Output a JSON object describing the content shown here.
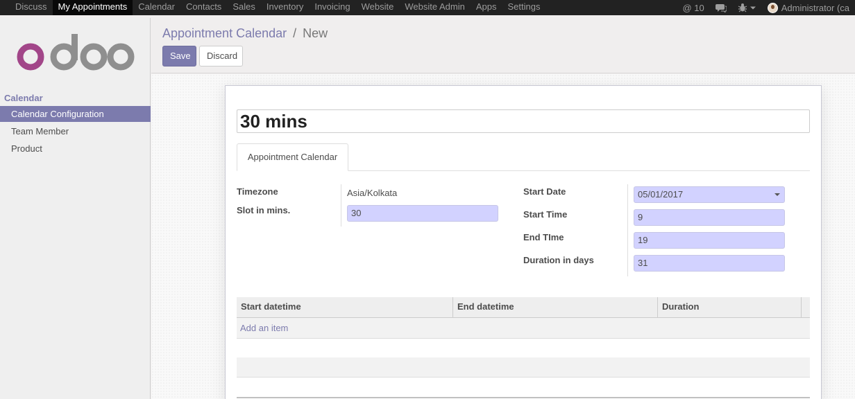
{
  "topbar": {
    "menu": [
      "Discuss",
      "My Appointments",
      "Calendar",
      "Contacts",
      "Sales",
      "Inventory",
      "Invoicing",
      "Website",
      "Website Admin",
      "Apps",
      "Settings"
    ],
    "active_index": 1,
    "notifications": "@ 10",
    "user": "Administrator (ca"
  },
  "sidebar": {
    "section": "Calendar",
    "items": [
      {
        "label": "Calendar Configuration",
        "active": true
      },
      {
        "label": "Team Member",
        "active": false
      },
      {
        "label": "Product",
        "active": false
      }
    ]
  },
  "control": {
    "breadcrumb_link": "Appointment Calendar",
    "breadcrumb_sep": "/",
    "breadcrumb_active": "New",
    "save_label": "Save",
    "discard_label": "Discard"
  },
  "form": {
    "name": "30 mins",
    "tab": "Appointment Calendar",
    "left": {
      "timezone_label": "Timezone",
      "timezone_value": "Asia/Kolkata",
      "slot_label": "Slot in mins.",
      "slot_value": "30"
    },
    "right": {
      "start_date_label": "Start Date",
      "start_date_value": "05/01/2017",
      "start_time_label": "Start Time",
      "start_time_value": "9",
      "end_time_label": "End TIme",
      "end_time_value": "19",
      "duration_label": "Duration in days",
      "duration_value": "31"
    },
    "table": {
      "columns": [
        "Start datetime",
        "End datetime",
        "Duration"
      ],
      "add_item": "Add an item"
    }
  },
  "colors": {
    "accent": "#7c7bad",
    "field_bg": "#d2d2ff",
    "topbar_bg": "#222222"
  }
}
